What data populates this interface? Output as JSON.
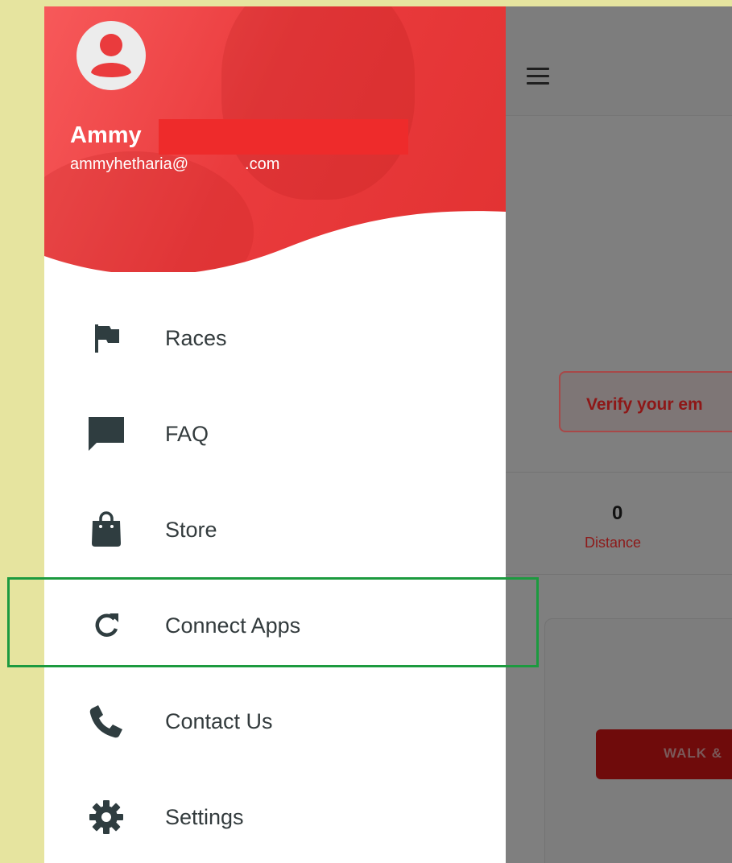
{
  "header": {
    "user_name": "Ammy",
    "user_email_prefix": "ammyhetharia@",
    "user_email_suffix": ".com",
    "avatar_icon": "account-circle-icon",
    "menu_icon": "hamburger-menu-icon"
  },
  "menu": {
    "items": [
      {
        "label": "Races",
        "icon": "flag-icon"
      },
      {
        "label": "FAQ",
        "icon": "chat-bubble-icon"
      },
      {
        "label": "Store",
        "icon": "shopping-bag-icon"
      },
      {
        "label": "Connect Apps",
        "icon": "refresh-icon"
      },
      {
        "label": "Contact Us",
        "icon": "phone-icon"
      },
      {
        "label": "Settings",
        "icon": "gear-icon"
      }
    ]
  },
  "main": {
    "verify_banner": "Verify your em",
    "stats": [
      {
        "value": "0",
        "label": "Distance"
      }
    ],
    "action_button": "WALK &"
  },
  "colors": {
    "brand_red": "#e23232",
    "highlight_green": "#1c9a3f",
    "page_background": "#e6e49f",
    "overlay_gray": "#7f7f7f"
  }
}
